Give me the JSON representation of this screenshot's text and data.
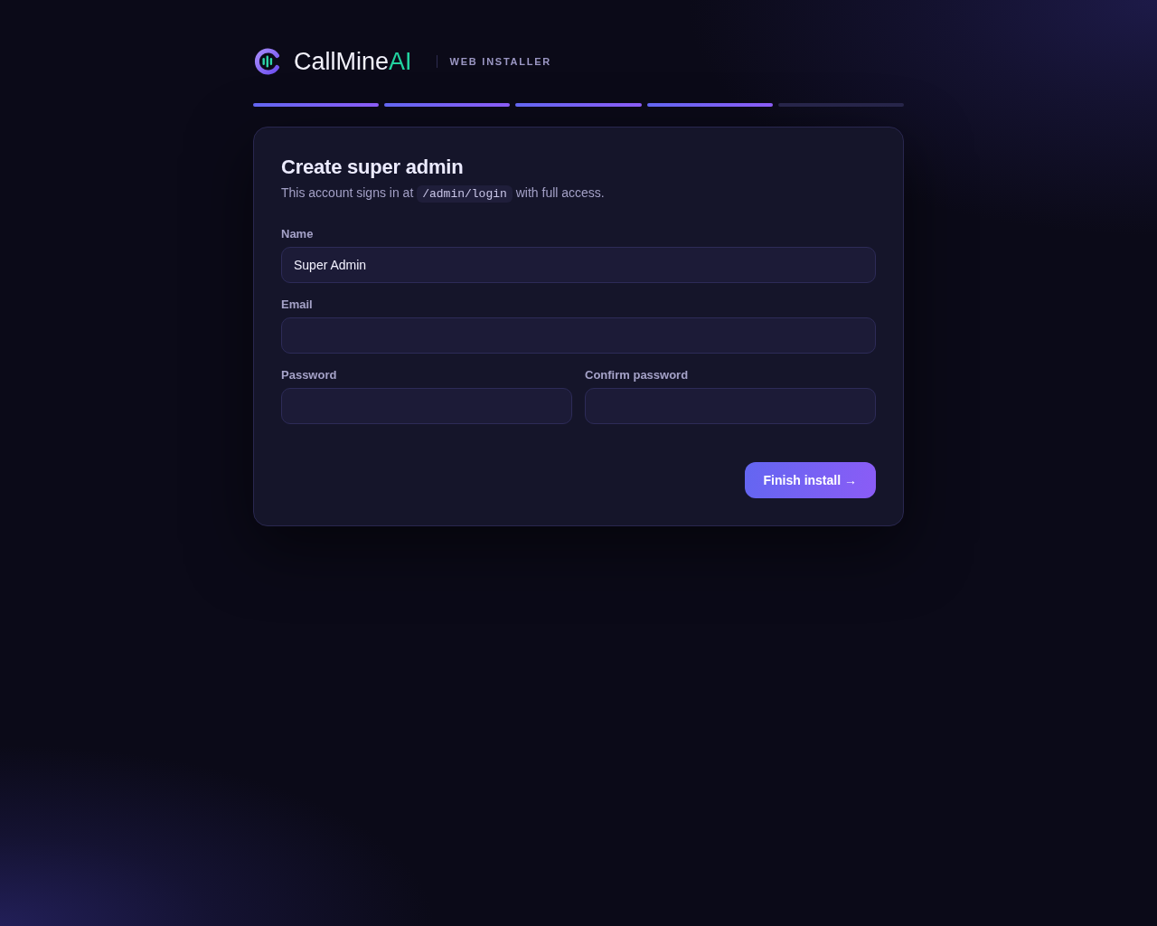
{
  "header": {
    "brand": {
      "name": "CallMine",
      "suffix": "AI"
    },
    "subtitle": "WEB INSTALLER"
  },
  "progress_steps": [
    {
      "done": true
    },
    {
      "done": true
    },
    {
      "done": true
    },
    {
      "done": true
    },
    {
      "done": false
    }
  ],
  "card": {
    "title": "Create super admin",
    "description": [
      {
        "kind": "text",
        "text": "This account signs in at"
      },
      {
        "kind": "code",
        "text": "/admin/login"
      },
      {
        "kind": "text",
        "text": "with full access."
      }
    ],
    "rows": [
      [
        {
          "label": "Name",
          "value": "Super Admin"
        }
      ],
      [
        {
          "label": "Email"
        }
      ],
      [
        {
          "label": "Password"
        },
        {
          "label": "Confirm password"
        }
      ]
    ],
    "submit_button": "Finish install →"
  }
}
